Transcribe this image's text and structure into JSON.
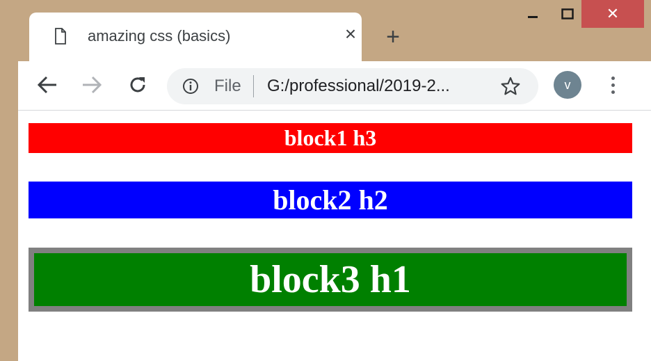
{
  "browser": {
    "tab": {
      "title": "amazing css (basics)",
      "close_glyph": "×"
    },
    "new_tab_glyph": "+",
    "window_controls": {
      "close_glyph": "✕"
    },
    "omnibox": {
      "scheme": "File",
      "url": "G:/professional/2019-2..."
    },
    "profile_initial": "v"
  },
  "page": {
    "block1": {
      "text": "block1 h3",
      "color": "#ff0000",
      "level": "h3"
    },
    "block2": {
      "text": "block2 h2",
      "color": "#0000ff",
      "level": "h2"
    },
    "block3": {
      "text": "block3 h1",
      "color": "#008000",
      "border_color": "#808080",
      "level": "h1"
    }
  },
  "icons": [
    "page-icon",
    "close-icon",
    "plus-icon",
    "minimize-icon",
    "maximize-icon",
    "window-close-icon",
    "back-arrow-icon",
    "forward-arrow-icon",
    "reload-icon",
    "info-icon",
    "star-icon",
    "kebab-menu-icon"
  ]
}
